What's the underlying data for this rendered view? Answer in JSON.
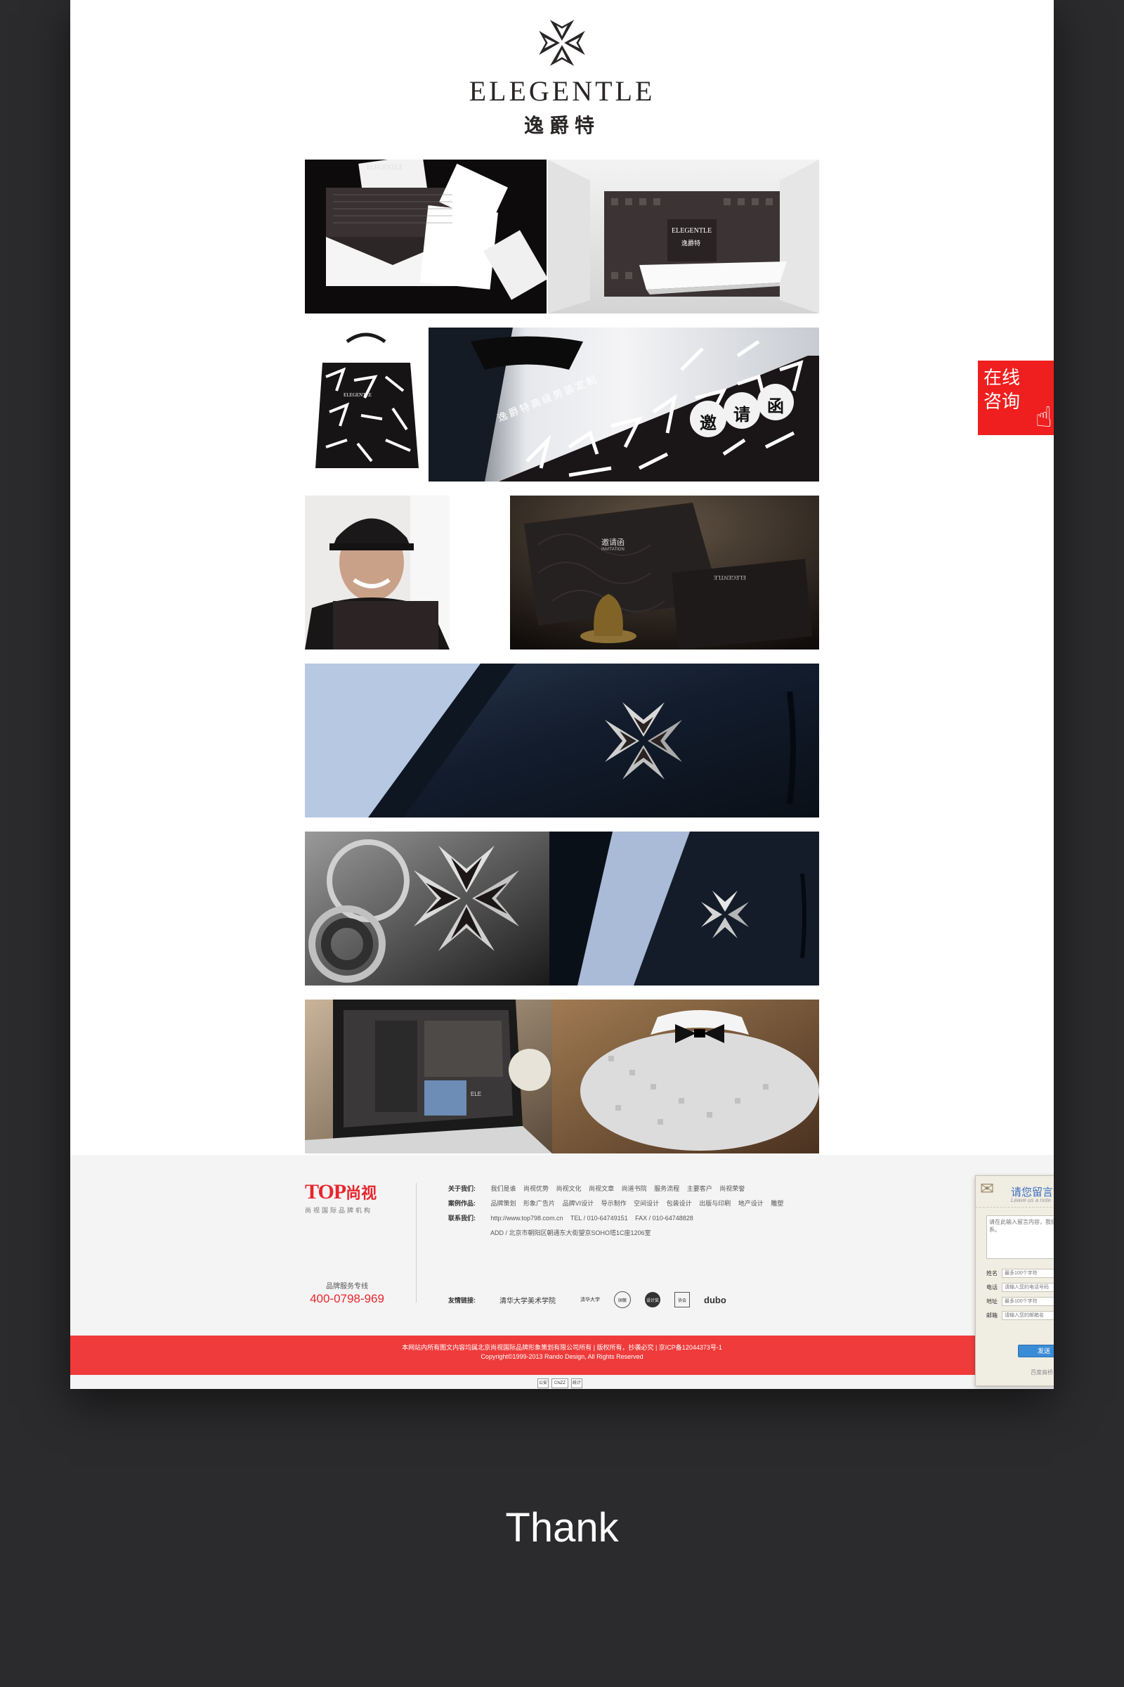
{
  "brand": {
    "wordmark": "ELEGENTLE",
    "chinese_name": "逸爵特",
    "icon": "maltese-cross-icon"
  },
  "gallery": {
    "row1": {
      "left_caption": "ELEGENTLE",
      "right_caption": "ELEGENTLE",
      "right_cn": "逸爵特"
    },
    "row2": {
      "bag_tag": "ELEGENTLE",
      "invitation_text": "逸爵特高级男装定制",
      "invitation_title": [
        "邀",
        "请",
        "函"
      ]
    },
    "row3": {
      "card_title": "邀请函",
      "card_sub": "INVITATION",
      "card_brand": "ELEGENTLE"
    },
    "row6": {
      "screen_label": "ELE"
    }
  },
  "consult": {
    "line1": "在线",
    "line2": "咨询",
    "icon": "pointing-hand-icon"
  },
  "footer": {
    "logo_top": "TOP",
    "logo_cn": "尚视",
    "logo_sub": "尚视国际品牌机构",
    "hotline_label": "品牌服务专线",
    "hotline_number": "400-0798-969",
    "about": {
      "label": "关于我们:",
      "items": [
        "我们是谁",
        "尚视优势",
        "尚视文化",
        "尚视文章",
        "尚道书院",
        "服务流程",
        "主要客户",
        "尚视荣誉"
      ]
    },
    "works": {
      "label": "案例作品:",
      "items": [
        "品牌策划",
        "形象广告片",
        "品牌VI设计",
        "导示制作",
        "空间设计",
        "包装设计",
        "出版与印刷",
        "地产设计",
        "雕塑"
      ]
    },
    "contact": {
      "label": "联系我们:",
      "site": "http://www.top798.com.cn",
      "tel": "TEL / 010-64749151",
      "fax": "FAX / 010-64748828",
      "address": "ADD / 北京市朝阳区朝通东大街望京SOHO塔1C座1206室"
    },
    "partners": {
      "label": "友情链接:",
      "items": [
        "清华大学美术学院",
        "清华大学",
        "国徽",
        "设计奖",
        "协会",
        "dubo"
      ]
    },
    "copyright_1": "本网站内所有图文内容均属北京尚视国际品牌形象策划有限公司所有 | 版权所有，抄袭必究 | 京ICP备12044373号-1",
    "copyright_2": "Copyright©1999-2013 Rando Design, All Rights Reserved",
    "badges": [
      "公安",
      "CNZZ",
      "统计"
    ]
  },
  "message_widget": {
    "title": "请您留言",
    "subtitle": "Leave us a note",
    "message_placeholder": "请在此输入留言内容，我们会尽快与您联系。",
    "fields": [
      {
        "label": "姓名",
        "placeholder": "最多100个字符"
      },
      {
        "label": "电话",
        "placeholder": "请输入您的电话号码"
      },
      {
        "label": "地址",
        "placeholder": "最多100个字符"
      },
      {
        "label": "邮箱",
        "placeholder": "请输入您的邮箱名"
      }
    ],
    "send_label": "发送",
    "footer_text": "百度商桥"
  },
  "closing_text": "Thank"
}
